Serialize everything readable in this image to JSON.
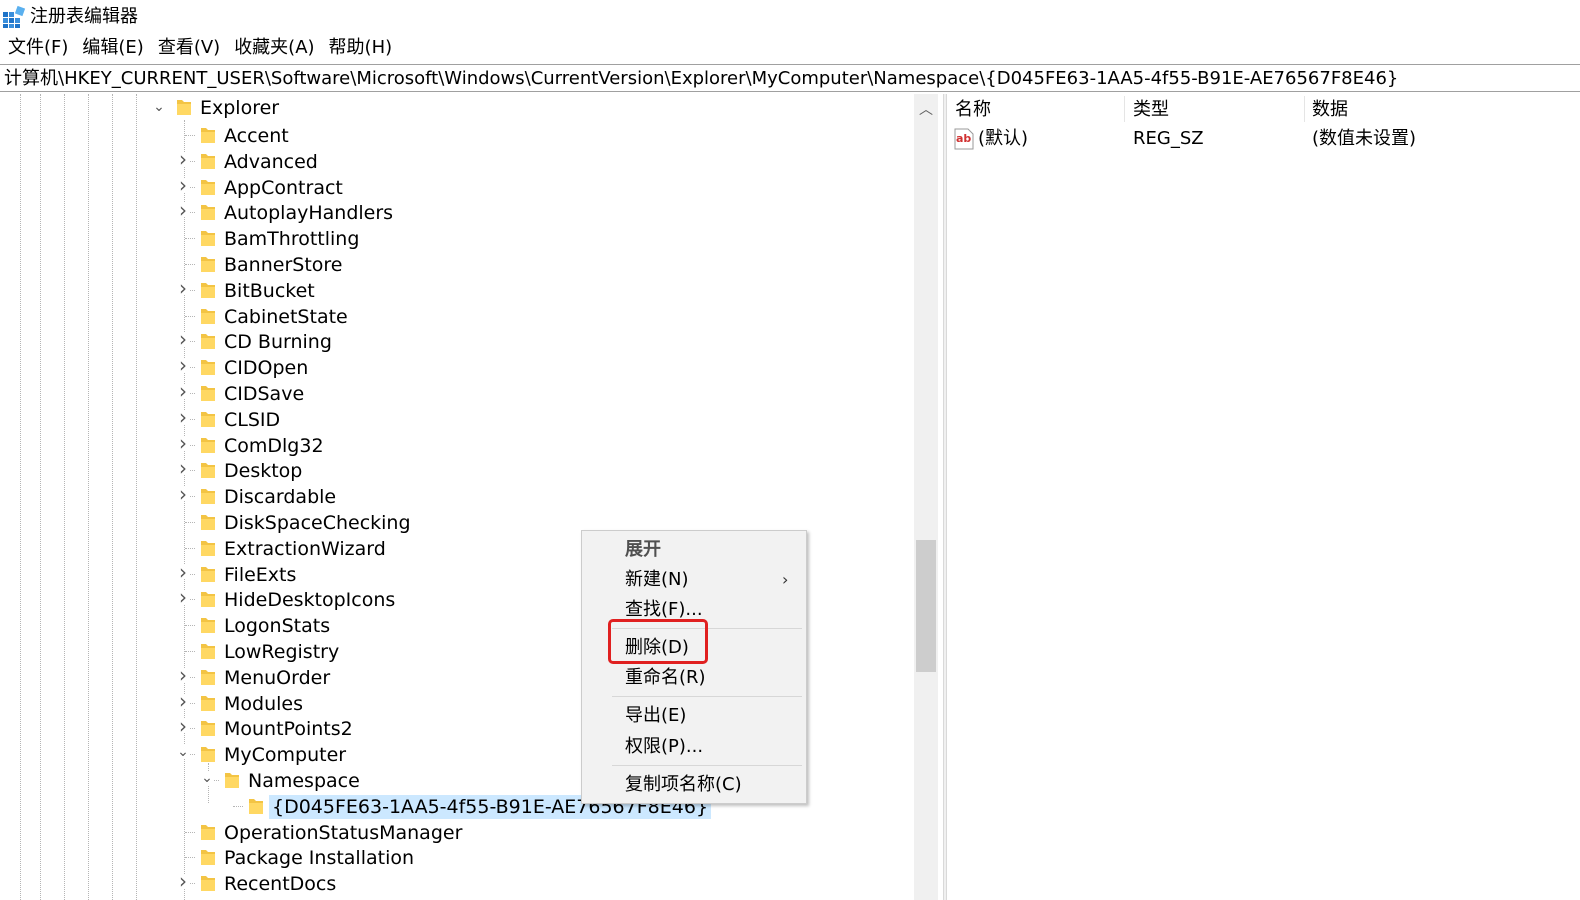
{
  "window": {
    "title": "注册表编辑器",
    "icon": "regedit-icon"
  },
  "menu": [
    "文件(F)",
    "编辑(E)",
    "查看(V)",
    "收藏夹(A)",
    "帮助(H)"
  ],
  "address": "计算机\\HKEY_CURRENT_USER\\Software\\Microsoft\\Windows\\CurrentVersion\\Explorer\\MyComputer\\Namespace\\{D045FE63-1AA5-4f55-B91E-AE76567F8E46}",
  "tree": {
    "explorer": "Explorer",
    "children": [
      "Accent",
      "Advanced",
      "AppContract",
      "AutoplayHandlers",
      "BamThrottling",
      "BannerStore",
      "BitBucket",
      "CabinetState",
      "CD Burning",
      "CIDOpen",
      "CIDSave",
      "CLSID",
      "ComDlg32",
      "Desktop",
      "Discardable",
      "DiskSpaceChecking",
      "ExtractionWizard",
      "FileExts",
      "HideDesktopIcons",
      "LogonStats",
      "LowRegistry",
      "MenuOrder",
      "Modules",
      "MountPoints2",
      "MyComputer"
    ],
    "namespace": "Namespace",
    "selected": "{D045FE63-1AA5-4f55-B91E-AE76567F8E46}",
    "after": [
      "OperationStatusManager",
      "Package Installation",
      "RecentDocs"
    ]
  },
  "values_pane": {
    "headers": {
      "name": "名称",
      "type": "类型",
      "data": "数据"
    },
    "rows": [
      {
        "name": "(默认)",
        "type": "REG_SZ",
        "data": "(数值未设置)",
        "icon": "string-value-icon"
      }
    ]
  },
  "context_menu": {
    "expand": "展开",
    "new": "新建(N)",
    "find": "查找(F)...",
    "delete": "删除(D)",
    "rename": "重命名(R)",
    "export": "导出(E)",
    "permissions": "权限(P)...",
    "copy_key_name": "复制项名称(C)",
    "highlight_color": "#e02020"
  }
}
